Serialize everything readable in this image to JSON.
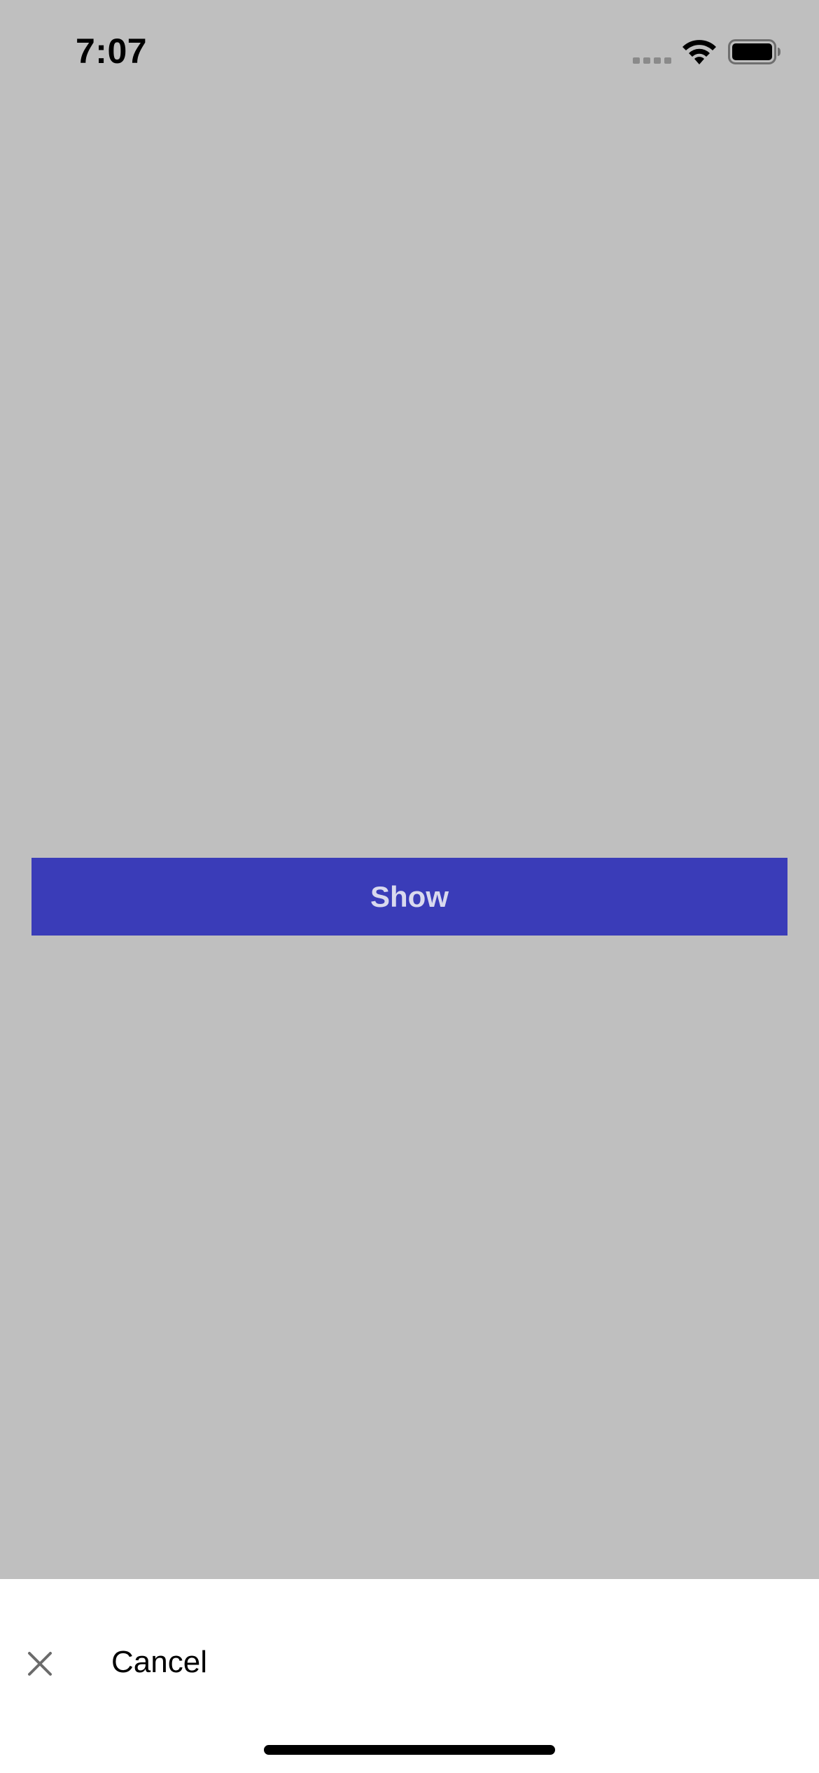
{
  "status_bar": {
    "time": "7:07",
    "signal_icon": "cellular-signal-icon",
    "wifi_icon": "wifi-icon",
    "battery_icon": "battery-icon"
  },
  "main": {
    "show_button_label": "Show"
  },
  "bottom_sheet": {
    "close_icon": "close-icon",
    "cancel_label": "Cancel"
  },
  "colors": {
    "background": "#bfbfbf",
    "button": "#3a3cb8",
    "button_text": "#d9d9ee",
    "sheet": "#ffffff"
  }
}
